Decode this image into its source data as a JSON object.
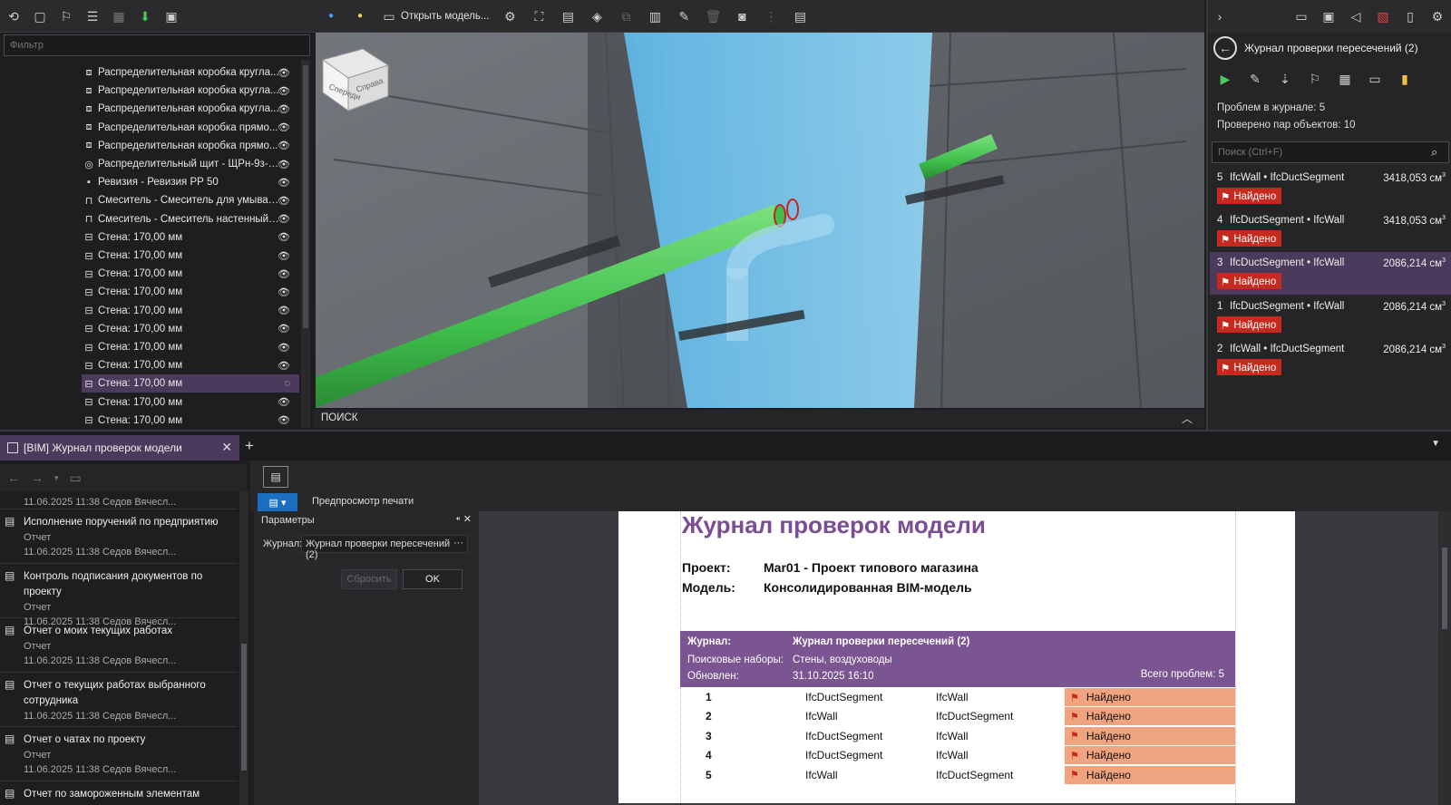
{
  "filter": {
    "placeholder": "Фильтр"
  },
  "tree": {
    "items": [
      {
        "label": "Распределительная коробка кругла...",
        "icon": "box-icon"
      },
      {
        "label": "Распределительная коробка кругла...",
        "icon": "box-icon"
      },
      {
        "label": "Распределительная коробка кругла...",
        "icon": "box-icon"
      },
      {
        "label": "Распределительная коробка прямо...",
        "icon": "box-icon"
      },
      {
        "label": "Распределительная коробка прямо...",
        "icon": "box-icon"
      },
      {
        "label": "Распределительный щит - ЩРн-9з-1...",
        "icon": "panel-icon"
      },
      {
        "label": "Ревизия - Ревизия РР 50",
        "icon": "fitting-icon"
      },
      {
        "label": "Смеситель - Смеситель для умывал...",
        "icon": "faucet-icon"
      },
      {
        "label": "Смеситель - Смеситель настенный д...",
        "icon": "faucet-icon"
      },
      {
        "label": "Стена: 170,00 мм",
        "icon": "wall-icon"
      },
      {
        "label": "Стена: 170,00 мм",
        "icon": "wall-icon"
      },
      {
        "label": "Стена: 170,00 мм",
        "icon": "wall-icon"
      },
      {
        "label": "Стена: 170,00 мм",
        "icon": "wall-icon"
      },
      {
        "label": "Стена: 170,00 мм",
        "icon": "wall-icon"
      },
      {
        "label": "Стена: 170,00 мм",
        "icon": "wall-icon"
      },
      {
        "label": "Стена: 170,00 мм",
        "icon": "wall-icon"
      },
      {
        "label": "Стена: 170,00 мм",
        "icon": "wall-icon"
      },
      {
        "label": "Стена: 170,00 мм",
        "icon": "wall-icon",
        "selected": true,
        "hidden": true
      },
      {
        "label": "Стена: 170,00 мм",
        "icon": "wall-icon"
      },
      {
        "label": "Стена: 170,00 мм",
        "icon": "wall-icon"
      }
    ]
  },
  "viewport": {
    "open_model_label": "Открыть модель...",
    "search_label": "ПОИСК",
    "navcube": {
      "front": "Спереди",
      "right": "Справа"
    }
  },
  "right_panel": {
    "title": "Журнал проверки пересечений (2)",
    "stats": {
      "issues": "Проблем в журнале: 5",
      "pairs": "Проверено пар объектов: 10"
    },
    "search_placeholder": "Поиск (Ctrl+F)",
    "issues": [
      {
        "no": "5",
        "pair": "IfcWall • IfcDuctSegment",
        "volume": "3418,053 см",
        "status": "Найдено"
      },
      {
        "no": "4",
        "pair": "IfcDuctSegment • IfcWall",
        "volume": "3418,053 см",
        "status": "Найдено"
      },
      {
        "no": "3",
        "pair": "IfcDuctSegment • IfcWall",
        "volume": "2086,214 см",
        "status": "Найдено",
        "selected": true
      },
      {
        "no": "1",
        "pair": "IfcDuctSegment • IfcWall",
        "volume": "2086,214 см",
        "status": "Найдено"
      },
      {
        "no": "2",
        "pair": "IfcWall • IfcDuctSegment",
        "volume": "2086,214 см",
        "status": "Найдено"
      }
    ],
    "volume_sup": "3"
  },
  "tabs": [
    {
      "label": "[BIM] Журнал проверок модели"
    }
  ],
  "reports": [
    {
      "title": "",
      "type": "",
      "meta": "11.06.2025 11:38 Седов Вячесл..."
    },
    {
      "title": "Исполнение поручений по предприятию",
      "type": "Отчет",
      "meta": "11.06.2025 11:38 Седов Вячесл..."
    },
    {
      "title": "Контроль подписания документов по проекту",
      "type": "Отчет",
      "meta": "11.06.2025 11:38 Седов Вячесл..."
    },
    {
      "title": "Отчет о моих текущих работах",
      "type": "Отчет",
      "meta": "11.06.2025 11:38 Седов Вячесл..."
    },
    {
      "title": "Отчет о текущих работах выбранного сотрудника",
      "type": "",
      "meta": "11.06.2025 11:38 Седов Вячесл..."
    },
    {
      "title": "Отчет о чатах по проекту",
      "type": "Отчет",
      "meta": "11.06.2025 11:38 Седов Вячесл..."
    },
    {
      "title": "Отчет по замороженным элементам",
      "type": "",
      "meta": ""
    }
  ],
  "params": {
    "print_preview_label": "Предпросмотр печати",
    "header": "Параметры",
    "journal_label": "Журнал:",
    "journal_value": "Журнал проверки пересечений (2)",
    "reset_label": "Сбросить",
    "ok_label": "OK"
  },
  "document": {
    "title": "Журнал проверок модели",
    "project_label": "Проект:",
    "project_value": "Mar01 - Проект типового магазина",
    "model_label": "Модель:",
    "model_value": "Консолидированная BIM-модель",
    "journal_label": "Журнал:",
    "journal_value": "Журнал проверки пересечений (2)",
    "sets_label": "Поисковые наборы:",
    "sets_value": "Стены, воздуховоды",
    "updated_label": "Обновлен:",
    "updated_value": "31.10.2025 16:10",
    "total": "Всего проблем: 5",
    "rows": [
      {
        "n": "1",
        "a": "IfcDuctSegment",
        "b": "IfcWall",
        "status": "Найдено"
      },
      {
        "n": "2",
        "a": "IfcWall",
        "b": "IfcDuctSegment",
        "status": "Найдено"
      },
      {
        "n": "3",
        "a": "IfcDuctSegment",
        "b": "IfcWall",
        "status": "Найдено"
      },
      {
        "n": "4",
        "a": "IfcDuctSegment",
        "b": "IfcWall",
        "status": "Найдено"
      },
      {
        "n": "5",
        "a": "IfcWall",
        "b": "IfcDuctSegment",
        "status": "Найдено"
      }
    ]
  },
  "colors": {
    "accent": "#7b4d94",
    "selection": "#4b3a5c",
    "status_red": "#c42a1e",
    "status_bg": "#f0a37f",
    "wall_blue": "#7cc6ea",
    "duct_green": "#4fc85a"
  }
}
